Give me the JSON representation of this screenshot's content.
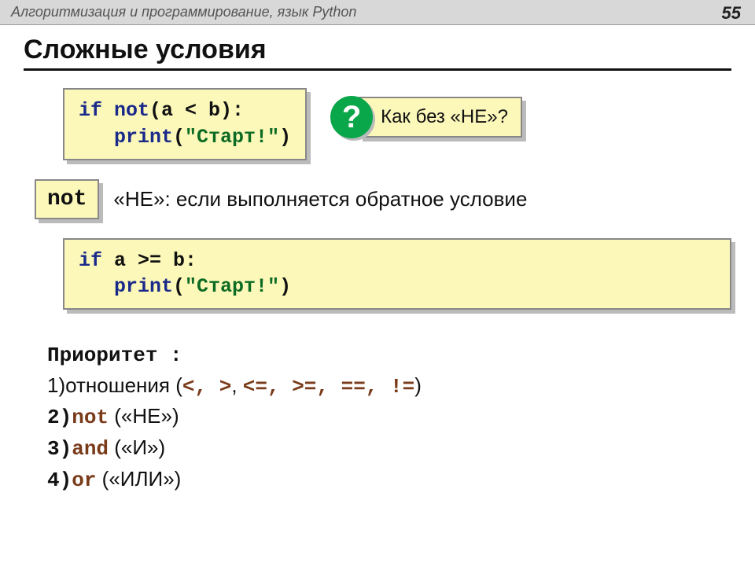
{
  "header": {
    "title": "Алгоритмизация и программирование, язык Python",
    "page": "55"
  },
  "title": "Сложные условия",
  "code1": {
    "l1a": "if",
    "l1b": " not",
    "l1c": "(a < b):",
    "l2a": "   print",
    "l2b": "(",
    "l2c": "\"Старт!\"",
    "l2d": ")"
  },
  "question": {
    "mark": "?",
    "text": "Как без «НЕ»?"
  },
  "notbox": "not",
  "notline": "«НЕ»: если выполняется обратное условие",
  "code2": {
    "l1a": "if",
    "l1b": " a >= b:",
    "l2a": "   print",
    "l2b": "(",
    "l2c": "\"Старт!\"",
    "l2d": ")"
  },
  "priority": {
    "title": "Приоритет :",
    "p1a": "1)отношения (",
    "p1b": "<, >",
    "p1c": ", ",
    "p1d": "<=, >=, ==, !=",
    "p1e": ")",
    "p2a": "2)",
    "p2b": "not",
    "p2c": " («НЕ»)",
    "p3a": "3)",
    "p3b": "and",
    "p3c": " («И»)",
    "p4a": "4)",
    "p4b": "or",
    "p4c": " («ИЛИ»)"
  }
}
